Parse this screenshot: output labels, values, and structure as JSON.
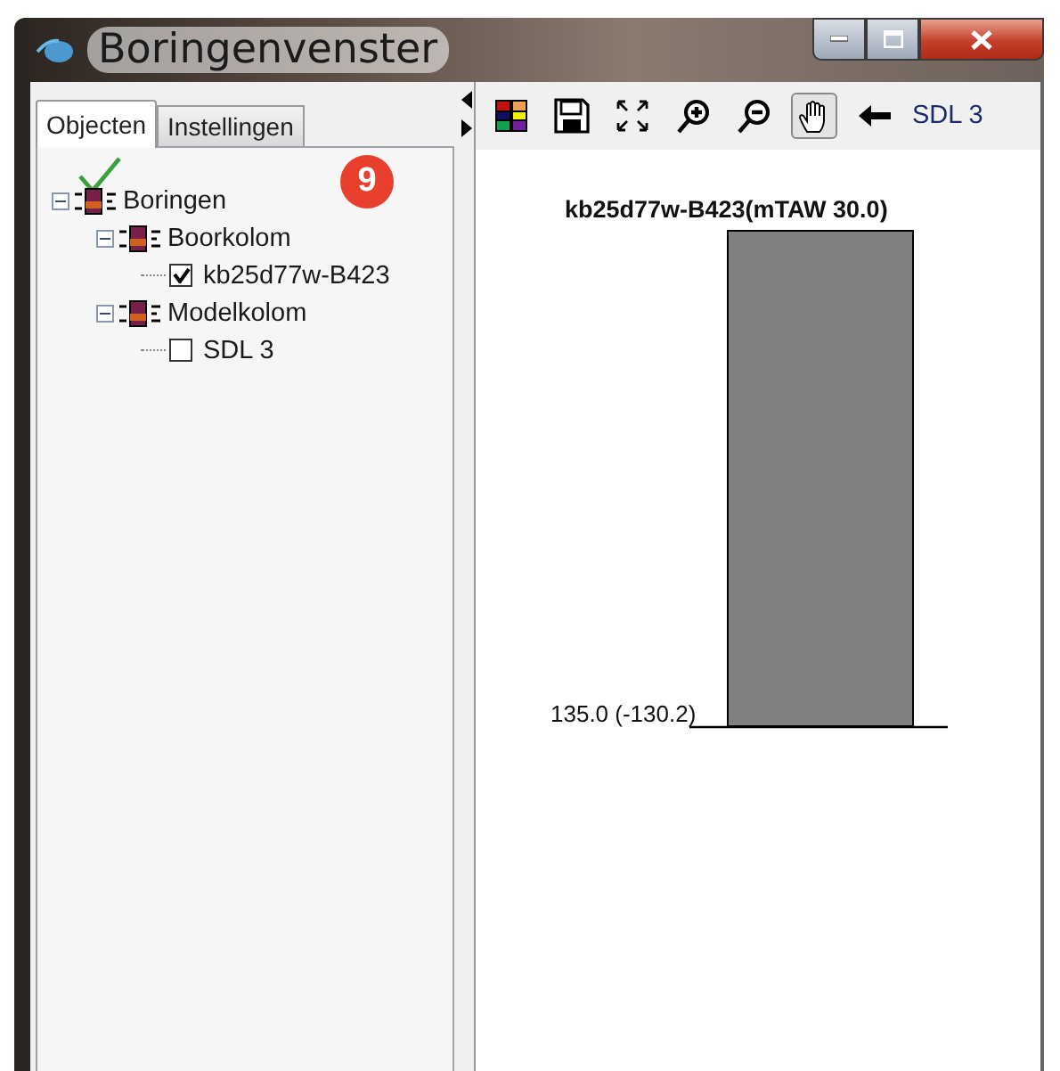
{
  "window": {
    "title": "Boringenvenster"
  },
  "tabs": [
    {
      "label": "Objecten",
      "selected": true
    },
    {
      "label": "Instellingen",
      "selected": false
    }
  ],
  "badge": "9",
  "tree": [
    {
      "kind": "group",
      "label": "Boringen",
      "expanded": true,
      "children": [
        {
          "kind": "group",
          "label": "Boorkolom",
          "expanded": true,
          "children": [
            {
              "kind": "leaf",
              "label": "kb25d77w-B423",
              "checked": true
            }
          ]
        },
        {
          "kind": "group",
          "label": "Modelkolom",
          "expanded": true,
          "children": [
            {
              "kind": "leaf",
              "label": "SDL 3",
              "checked": false
            }
          ]
        }
      ]
    }
  ],
  "toolbar": {
    "tools": [
      {
        "kind": "colors",
        "selected": false
      },
      {
        "kind": "save",
        "selected": false
      },
      {
        "kind": "fit",
        "selected": false
      },
      {
        "kind": "zoom_in",
        "selected": false
      },
      {
        "kind": "zoom_out",
        "selected": false
      },
      {
        "kind": "pan",
        "selected": true
      },
      {
        "kind": "back",
        "selected": false
      }
    ],
    "label": "SDL 3"
  },
  "column": {
    "title": "kb25d77w-B423(mTAW 30.0)",
    "depth_label": "135.0 (-130.2)"
  }
}
